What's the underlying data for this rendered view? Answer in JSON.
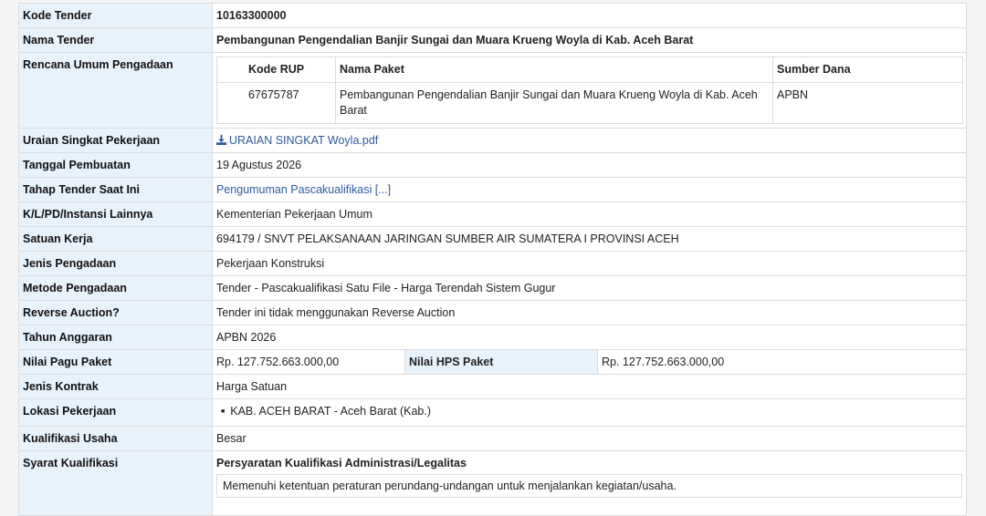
{
  "rows": {
    "kode_tender": {
      "label": "Kode Tender",
      "value": "10163300000"
    },
    "nama_tender": {
      "label": "Nama Tender",
      "value": "Pembangunan Pengendalian Banjir Sungai dan Muara Krueng Woyla di Kab. Aceh Barat"
    },
    "rup": {
      "label": "Rencana Umum Pengadaan",
      "headers": [
        "Kode RUP",
        "Nama Paket",
        "Sumber Dana"
      ],
      "row": [
        "67675787",
        "Pembangunan Pengendalian Banjir Sungai dan Muara Krueng Woyla di Kab. Aceh Barat",
        "APBN"
      ]
    },
    "uraian": {
      "label": "Uraian Singkat Pekerjaan",
      "value": "URAIAN SINGKAT Woyla.pdf",
      "icon": "download-icon"
    },
    "tanggal": {
      "label": "Tanggal Pembuatan",
      "value": "19 Agustus 2026"
    },
    "tahap": {
      "label": "Tahap Tender Saat Ini",
      "value": "Pengumuman Pascakualifikasi [...]"
    },
    "klpd": {
      "label": "K/L/PD/Instansi Lainnya",
      "value": "Kementerian Pekerjaan Umum"
    },
    "satker": {
      "label": "Satuan Kerja",
      "value": "694179 / SNVT PELAKSANAAN JARINGAN SUMBER AIR SUMATERA I PROVINSI ACEH"
    },
    "jenis": {
      "label": "Jenis Pengadaan",
      "value": "Pekerjaan Konstruksi"
    },
    "metode": {
      "label": "Metode Pengadaan",
      "value": "Tender - Pascakualifikasi Satu File - Harga Terendah Sistem Gugur"
    },
    "reverse": {
      "label": "Reverse Auction?",
      "value": "Tender ini tidak menggunakan Reverse Auction"
    },
    "tahun": {
      "label": "Tahun Anggaran",
      "value": "APBN 2026"
    },
    "pagu": {
      "label": "Nilai Pagu Paket",
      "value": "Rp. 127.752.663.000,00",
      "hps_label": "Nilai HPS Paket",
      "hps_value": "Rp. 127.752.663.000,00"
    },
    "kontrak": {
      "label": "Jenis Kontrak",
      "value": "Harga Satuan"
    },
    "lokasi": {
      "label": "Lokasi Pekerjaan",
      "items": [
        "KAB. ACEH BARAT - Aceh Barat (Kab.)"
      ]
    },
    "kualifikasi": {
      "label": "Kualifikasi Usaha",
      "value": "Besar"
    },
    "syarat": {
      "label": "Syarat Kualifikasi",
      "heading": "Persyaratan Kualifikasi Administrasi/Legalitas",
      "item": "Memenuhi ketentuan peraturan perundang-undangan untuk menjalankan kegiatan/usaha."
    }
  },
  "colors": {
    "label_bg": "#e8f2fb",
    "link": "#2f5a9e",
    "border": "#dcdcdc"
  }
}
